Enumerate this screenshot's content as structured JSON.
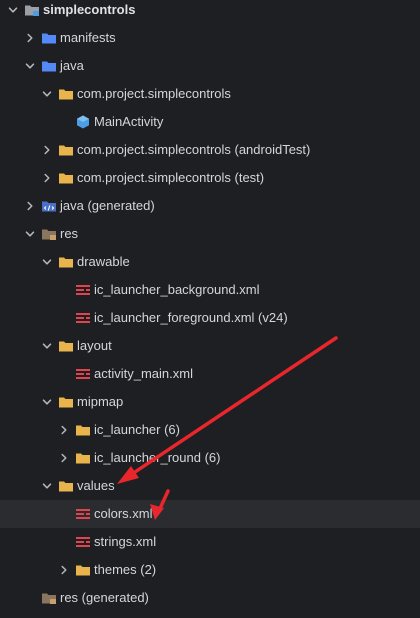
{
  "project_tree": {
    "colors": {
      "folder_blue": "#548af7",
      "folder_yellow": "#e8b44b",
      "res_folder": "#8a7560",
      "xml_red": "#e0444e",
      "activity_blue": "#4c9de6",
      "arrow_red": "#e8262b",
      "background": "#1e1f22",
      "selection": "#2a2c30",
      "text": "#d4d6db"
    },
    "items": [
      {
        "label": "simplecontrols",
        "icon": "module-folder-icon",
        "chevron": "down",
        "bold": true
      },
      {
        "label": "manifests",
        "icon": "folder-blue-icon",
        "chevron": "right"
      },
      {
        "label": "java",
        "icon": "folder-blue-icon",
        "chevron": "down"
      },
      {
        "label": "com.project.simplecontrols",
        "icon": "package-folder-icon",
        "chevron": "down"
      },
      {
        "label": "MainActivity",
        "icon": "activity-class-icon",
        "chevron": "none"
      },
      {
        "label": "com.project.simplecontrols (androidTest)",
        "icon": "package-folder-icon",
        "chevron": "right"
      },
      {
        "label": "com.project.simplecontrols (test)",
        "icon": "package-folder-icon",
        "chevron": "right"
      },
      {
        "label": "java (generated)",
        "icon": "generated-source-folder-icon",
        "chevron": "right"
      },
      {
        "label": "res",
        "icon": "resource-folder-icon",
        "chevron": "down"
      },
      {
        "label": "drawable",
        "icon": "folder-yellow-icon",
        "chevron": "down"
      },
      {
        "label": "ic_launcher_background.xml",
        "icon": "xml-file-icon",
        "chevron": "none"
      },
      {
        "label": "ic_launcher_foreground.xml (v24)",
        "icon": "xml-file-icon",
        "chevron": "none"
      },
      {
        "label": "layout",
        "icon": "folder-yellow-icon",
        "chevron": "down"
      },
      {
        "label": "activity_main.xml",
        "icon": "xml-file-icon",
        "chevron": "none"
      },
      {
        "label": "mipmap",
        "icon": "folder-yellow-icon",
        "chevron": "down"
      },
      {
        "label": "ic_launcher (6)",
        "icon": "folder-yellow-icon",
        "chevron": "right"
      },
      {
        "label": "ic_launcher_round (6)",
        "icon": "folder-yellow-icon",
        "chevron": "right"
      },
      {
        "label": "values",
        "icon": "folder-yellow-icon",
        "chevron": "down"
      },
      {
        "label": "colors.xml",
        "icon": "xml-file-icon",
        "chevron": "none",
        "selected": true
      },
      {
        "label": "strings.xml",
        "icon": "xml-file-icon",
        "chevron": "none"
      },
      {
        "label": "themes (2)",
        "icon": "folder-yellow-icon",
        "chevron": "right"
      },
      {
        "label": "res (generated)",
        "icon": "generated-resource-folder-icon",
        "chevron": "none"
      }
    ]
  }
}
